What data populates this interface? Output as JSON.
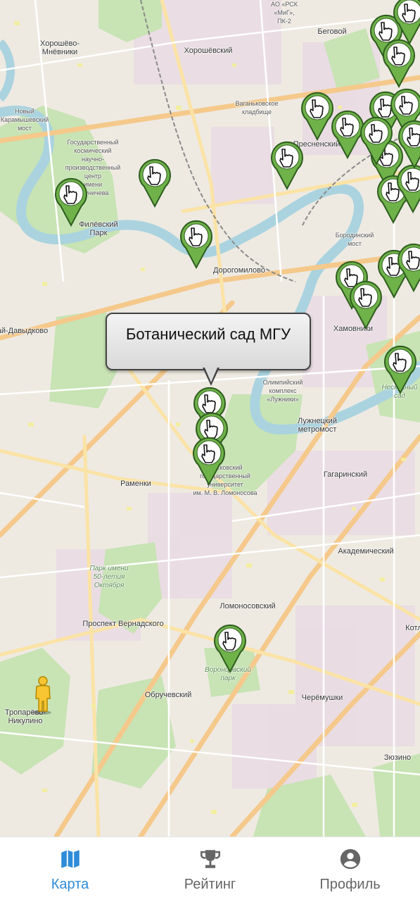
{
  "map": {
    "tooltip": "Ботанический сад МГУ",
    "district_labels": [
      {
        "name": "label-khoroshevo-mnevniki",
        "text": "Хорошёво-\nМнёвники"
      },
      {
        "name": "label-khoroshevsky",
        "text": "Хорошёвский"
      },
      {
        "name": "label-begovoy",
        "text": "Беговой"
      },
      {
        "name": "label-novy-karamyshevsky",
        "text": "Новый\nКарамышевский\nмост"
      },
      {
        "name": "label-vagankovskoe",
        "text": "Ваганьковское\nкладбище"
      },
      {
        "name": "label-presnensky",
        "text": "Пресненский"
      },
      {
        "name": "label-space-center",
        "text": "Государственный\nкосмический\nнаучно-\nпроизводственный\nцентр\nимени\nХруничева"
      },
      {
        "name": "label-filevsky-park",
        "text": "Филёвский\nПарк"
      },
      {
        "name": "label-dorogomilovo",
        "text": "Дорогомилово"
      },
      {
        "name": "label-borodinsky",
        "text": "Бородинский\nмост"
      },
      {
        "name": "label-davydkovo",
        "text": "ай-Давыдково"
      },
      {
        "name": "label-khamovniki",
        "text": "Хамовники"
      },
      {
        "name": "label-luzhniki",
        "text": "Олимпийский\nкомплекс\n«Лужники»"
      },
      {
        "name": "label-luzhnetsky",
        "text": "Лужнецкий\nметромост"
      },
      {
        "name": "label-ramenki",
        "text": "Раменки"
      },
      {
        "name": "label-msu",
        "text": "Московский\nгосударственный\nуниверситет\nим. М. В. Ломоносова"
      },
      {
        "name": "label-gagarinsky",
        "text": "Гагаринский"
      },
      {
        "name": "label-akademichesky",
        "text": "Академический"
      },
      {
        "name": "label-lomonosovsky",
        "text": "Ломоносовский"
      },
      {
        "name": "label-prospekt-vernadskogo",
        "text": "Проспект Вернадского"
      },
      {
        "name": "label-park-50",
        "text": "Парк имени\n50-летия\nОктября"
      },
      {
        "name": "label-obruchevsky",
        "text": "Обручевский"
      },
      {
        "name": "label-troparevo",
        "text": "Тропарёво-\nНикулино"
      },
      {
        "name": "label-cheryomushki",
        "text": "Черёмушки"
      },
      {
        "name": "label-zyuzino",
        "text": "Зюзино"
      },
      {
        "name": "label-vorontsovsky",
        "text": "Воронцовский\nпарк"
      },
      {
        "name": "label-neskuchny",
        "text": "Нескучный\nсад"
      },
      {
        "name": "label-mig",
        "text": "АО «РСК\n«МиГ»,\nПК-2"
      },
      {
        "name": "label-kotl",
        "text": "Котл"
      }
    ]
  },
  "nav": {
    "items": [
      {
        "label": "Карта",
        "icon": "map-icon",
        "active": true
      },
      {
        "label": "Рейтинг",
        "icon": "trophy-icon",
        "active": false
      },
      {
        "label": "Профиль",
        "icon": "account-circle-icon",
        "active": false
      }
    ]
  },
  "colors": {
    "marker_green": "#6fb24a",
    "nav_active": "#2e8bd8",
    "river": "#aad3df",
    "park": "#c8e3b4"
  }
}
